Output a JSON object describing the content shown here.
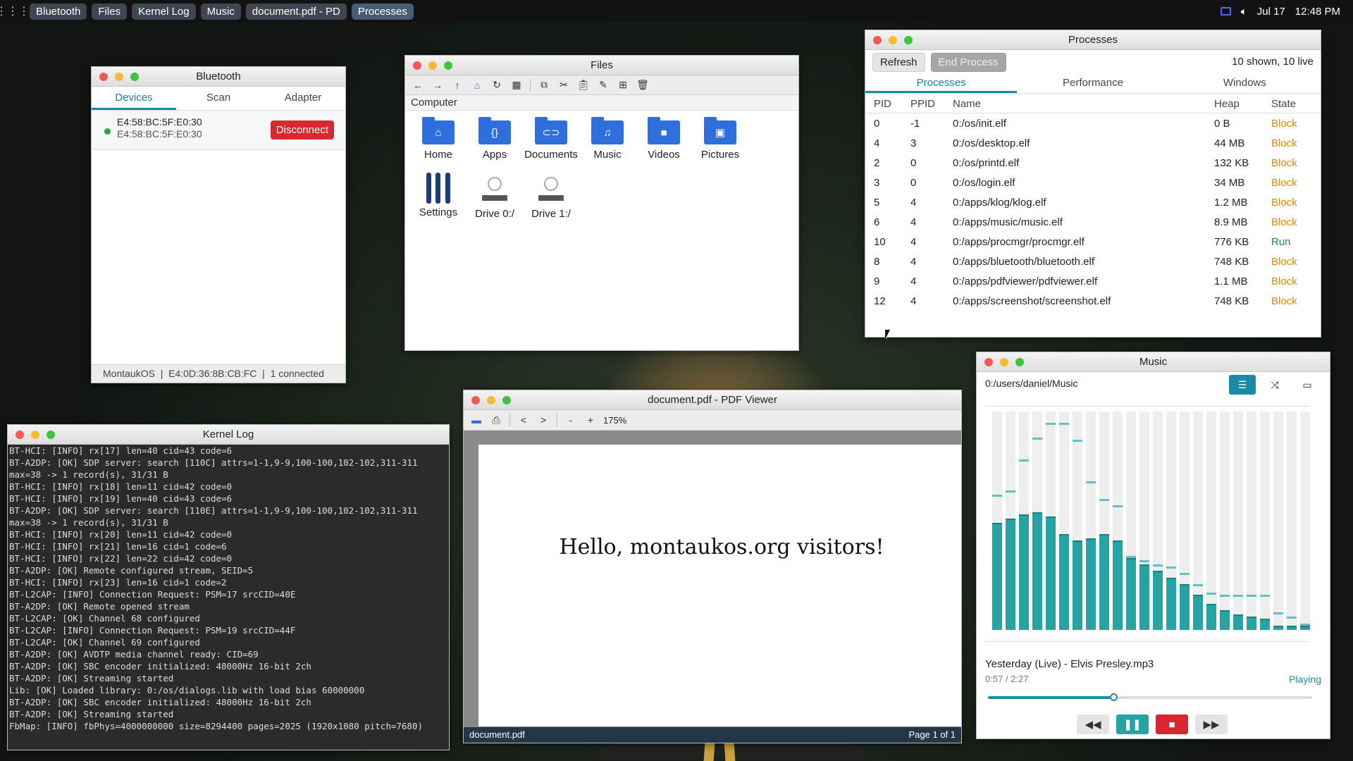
{
  "taskbar": {
    "items": [
      "Bluetooth",
      "Files",
      "Kernel Log",
      "Music",
      "document.pdf - PD",
      "Processes"
    ],
    "date": "Jul 17",
    "time": "12:48 PM"
  },
  "bluetooth": {
    "title": "Bluetooth",
    "tabs": [
      "Devices",
      "Scan",
      "Adapter"
    ],
    "device_name": "E4:58:BC:5F:E0:30",
    "device_addr": "E4:58:BC:5F:E0:30",
    "disconnect_label": "Disconnect",
    "status": "MontaukOS  |  E4:0D:36:8B:CB:FC  |  1 connected"
  },
  "files": {
    "title": "Files",
    "path": "Computer",
    "items": [
      "Home",
      "Apps",
      "Documents",
      "Music",
      "Videos",
      "Pictures",
      "Settings",
      "Drive 0:/",
      "Drive 1:/"
    ]
  },
  "processes": {
    "title": "Processes",
    "refresh_label": "Refresh",
    "end_label": "End Process",
    "count": "10 shown, 10 live",
    "tabs": [
      "Processes",
      "Performance",
      "Windows"
    ],
    "columns": [
      "PID",
      "PPID",
      "Name",
      "Heap",
      "State"
    ],
    "rows": [
      [
        "0",
        "-1",
        "0:/os/init.elf",
        "0 B",
        "Block"
      ],
      [
        "4",
        "3",
        "0:/os/desktop.elf",
        "44 MB",
        "Block"
      ],
      [
        "2",
        "0",
        "0:/os/printd.elf",
        "132 KB",
        "Block"
      ],
      [
        "3",
        "0",
        "0:/os/login.elf",
        "34 MB",
        "Block"
      ],
      [
        "5",
        "4",
        "0:/apps/klog/klog.elf",
        "1.2 MB",
        "Block"
      ],
      [
        "6",
        "4",
        "0:/apps/music/music.elf",
        "8.9 MB",
        "Block"
      ],
      [
        "10",
        "4",
        "0:/apps/procmgr/procmgr.elf",
        "776 KB",
        "Run"
      ],
      [
        "8",
        "4",
        "0:/apps/bluetooth/bluetooth.elf",
        "748 KB",
        "Block"
      ],
      [
        "9",
        "4",
        "0:/apps/pdfviewer/pdfviewer.elf",
        "1.1 MB",
        "Block"
      ],
      [
        "12",
        "4",
        "0:/apps/screenshot/screenshot.elf",
        "748 KB",
        "Block"
      ]
    ]
  },
  "kernel_log": {
    "title": "Kernel Log",
    "lines": [
      "BT-HCI: [INFO] rx[17] len=40 cid=43 code=6",
      "BT-A2DP: [OK] SDP server: search [110C] attrs=1-1,9-9,100-100,102-102,311-311",
      "max=38 -> 1 record(s), 31/31 B",
      "BT-HCI: [INFO] rx[18] len=11 cid=42 code=0",
      "BT-HCI: [INFO] rx[19] len=40 cid=43 code=6",
      "BT-A2DP: [OK] SDP server: search [110E] attrs=1-1,9-9,100-100,102-102,311-311",
      "max=38 -> 1 record(s), 31/31 B",
      "BT-HCI: [INFO] rx[20] len=11 cid=42 code=0",
      "BT-HCI: [INFO] rx[21] len=16 cid=1 code=6",
      "BT-HCI: [INFO] rx[22] len=22 cid=42 code=0",
      "BT-A2DP: [OK] Remote configured stream, SEID=5",
      "BT-HCI: [INFO] rx[23] len=16 cid=1 code=2",
      "BT-L2CAP: [INFO] Connection Request: PSM=17 srcCID=40E",
      "BT-A2DP: [OK] Remote opened stream",
      "BT-L2CAP: [OK] Channel 68 configured",
      "BT-L2CAP: [INFO] Connection Request: PSM=19 srcCID=44F",
      "BT-L2CAP: [OK] Channel 69 configured",
      "BT-A2DP: [OK] AVDTP media channel ready: CID=69",
      "BT-A2DP: [OK] SBC encoder initialized: 48000Hz 16-bit 2ch",
      "BT-A2DP: [OK] Streaming started",
      "Lib: [OK] Loaded library: 0:/os/dialogs.lib with load bias 60000000",
      "BT-A2DP: [OK] SBC encoder initialized: 48000Hz 16-bit 2ch",
      "BT-A2DP: [OK] Streaming started",
      "FbMap: [INFO] fbPhys=4000000000 size=8294400 pages=2025 (1920x1080 pitch=7680)"
    ]
  },
  "pdf": {
    "title": "document.pdf - PDF Viewer",
    "zoom": "175%",
    "prev": "<",
    "next": ">",
    "zoom_out": "-",
    "zoom_in": "+",
    "content": "Hello, montaukos.org visitors!",
    "filename": "document.pdf",
    "page": "Page 1 of 1"
  },
  "music": {
    "title": "Music",
    "path": "0:/users/daniel/Music",
    "track": "Yesterday (Live) - Elvis Presley.mp3",
    "time": "0:57 / 2:27",
    "state": "Playing",
    "progress": 0.39,
    "spectrum_levels": [
      0.49,
      0.51,
      0.53,
      0.54,
      0.52,
      0.44,
      0.41,
      0.42,
      0.44,
      0.41,
      0.33,
      0.3,
      0.27,
      0.24,
      0.21,
      0.16,
      0.12,
      0.09,
      0.07,
      0.06,
      0.05,
      0.02,
      0.02,
      0.02
    ],
    "spectrum_peaks": [
      0.61,
      0.63,
      0.77,
      0.87,
      0.94,
      0.94,
      0.86,
      0.67,
      0.59,
      0.56,
      0.33,
      0.31,
      0.29,
      0.28,
      0.25,
      0.2,
      0.16,
      0.15,
      0.15,
      0.15,
      0.15,
      0.07,
      0.05,
      0.02
    ],
    "accent": "#26a3a3"
  },
  "colors": {
    "block": "#e08a00",
    "run": "#1e8e3e",
    "accent": "#1b8aa8",
    "disconnect": "#d7282f"
  }
}
